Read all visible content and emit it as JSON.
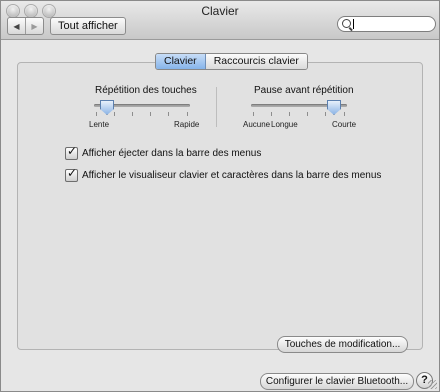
{
  "window": {
    "title": "Clavier"
  },
  "toolbar": {
    "show_all_label": "Tout afficher",
    "back_icon": "back-arrow-icon",
    "forward_icon": "forward-arrow-icon",
    "search_value": ""
  },
  "tabs": [
    {
      "label": "Clavier",
      "active": true
    },
    {
      "label": "Raccourcis clavier",
      "active": false
    }
  ],
  "repeat": {
    "label": "Répétition des touches",
    "min_label": "Lente",
    "max_label": "Rapide",
    "level": 0.12
  },
  "delay": {
    "label": "Pause avant répétition",
    "labels": [
      "Aucune",
      "Longue",
      "Courte"
    ],
    "level": 0.85
  },
  "options": [
    {
      "label": "Afficher éjecter dans la barre des menus",
      "checked": true
    },
    {
      "label": "Afficher le visualiseur clavier et caractères dans la barre des menus",
      "checked": true
    }
  ],
  "buttons": {
    "modifier_keys": "Touches de modification...",
    "bluetooth": "Configurer le clavier Bluetooth...",
    "help": "?"
  }
}
